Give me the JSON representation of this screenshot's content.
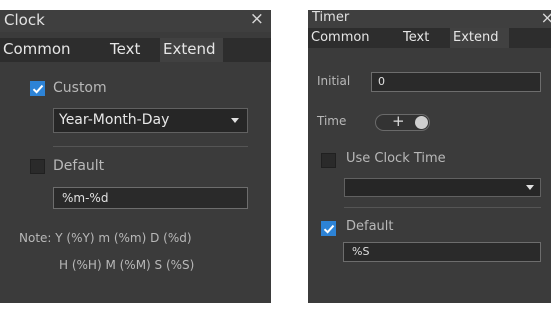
{
  "clock": {
    "title": "Clock",
    "close_glyph": "×",
    "tabs": [
      "Common",
      "Text",
      "Extend"
    ],
    "active_tab": "Extend",
    "custom": {
      "label": "Custom",
      "checked": true
    },
    "format_select": {
      "value": "Year-Month-Day"
    },
    "default": {
      "label": "Default",
      "checked": false
    },
    "format_input": {
      "value": "%m-%d"
    },
    "note_line1": "Note: Y (%Y) m (%m) D (%d)",
    "note_line2": "H (%H) M (%M) S (%S)"
  },
  "timer": {
    "title": "Timer",
    "close_glyph": "×",
    "tabs": [
      "Common",
      "Text",
      "Extend"
    ],
    "active_tab": "Extend",
    "initial": {
      "label": "Initial",
      "value": "0"
    },
    "time": {
      "label": "Time",
      "toggle_glyph": "+"
    },
    "use_clock_time": {
      "label": "Use Clock Time",
      "checked": false
    },
    "clock_select": {
      "value": ""
    },
    "default": {
      "label": "Default",
      "checked": true
    },
    "format_input": {
      "value": "%S"
    }
  },
  "colors": {
    "panel_bg": "#3b3b3b",
    "tab_bar_bg": "#2d2d2d",
    "active_tab_bg": "#414141",
    "checkbox_checked": "#2d83d6"
  }
}
